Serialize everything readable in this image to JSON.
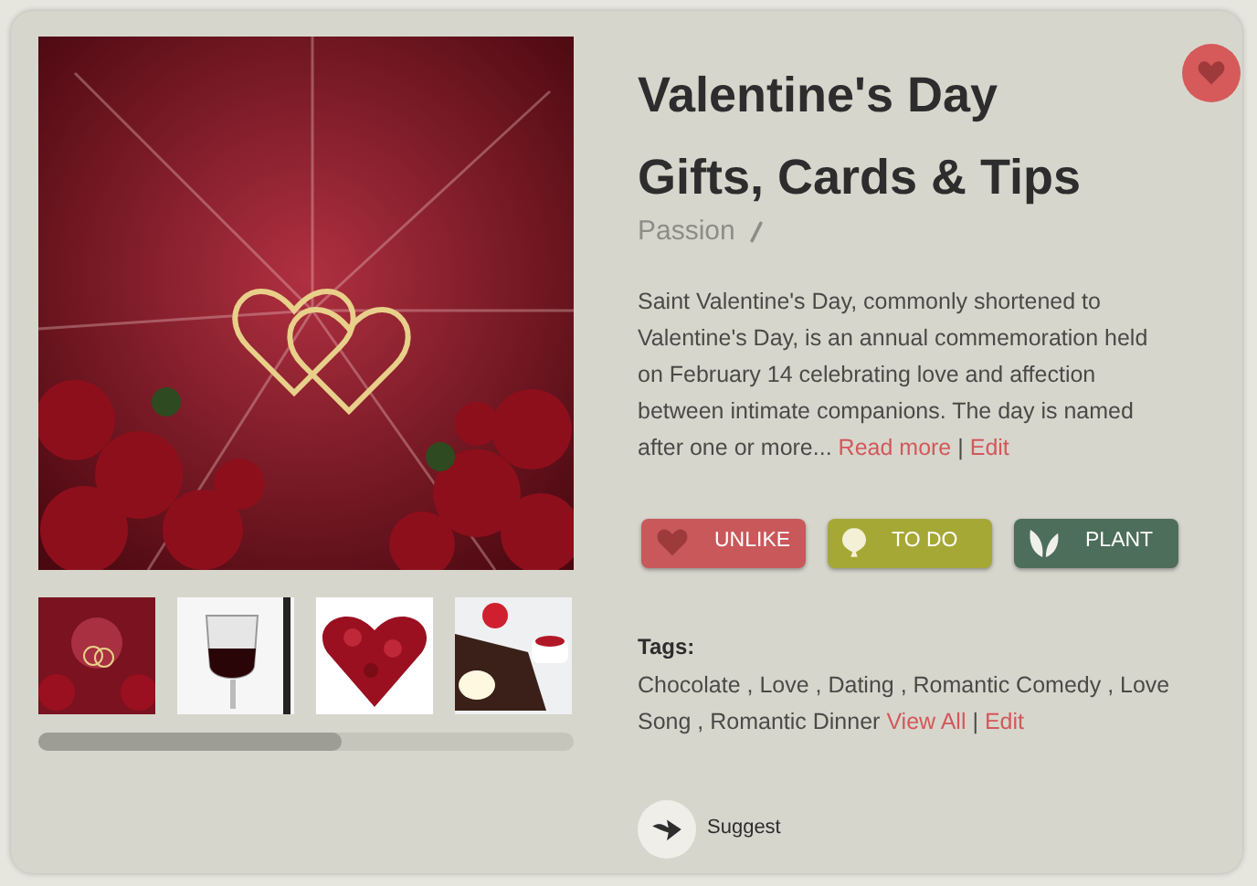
{
  "title_lines": [
    "Valentine's Day",
    "Gifts, Cards & Tips"
  ],
  "favorite": {
    "on": true
  },
  "category": "Passion",
  "description": {
    "text": "Saint Valentine's Day, commonly shortened to Valentine's Day, is an annual commemoration held on February 14 celebrating love and affection between intimate companions. The day is named after one or more...",
    "read_more": "Read more",
    "separator": "|",
    "edit": "Edit"
  },
  "actions": [
    {
      "kind": "heart",
      "label": "UNLIKE"
    },
    {
      "kind": "balloon",
      "label": "TO DO"
    },
    {
      "kind": "leaf",
      "label": "PLANT"
    }
  ],
  "gallery": {
    "thumbnails": [
      {
        "kind": "card"
      },
      {
        "kind": "wine"
      },
      {
        "kind": "roses"
      },
      {
        "kind": "cake"
      }
    ]
  },
  "tags": {
    "heading": "Tags:",
    "text": "Chocolate , Love , Dating , Romantic Comedy , Love Song , Romantic Dinner",
    "view_all": "View All",
    "separator": "|",
    "edit": "Edit"
  },
  "suggest": {
    "label": "Suggest"
  }
}
